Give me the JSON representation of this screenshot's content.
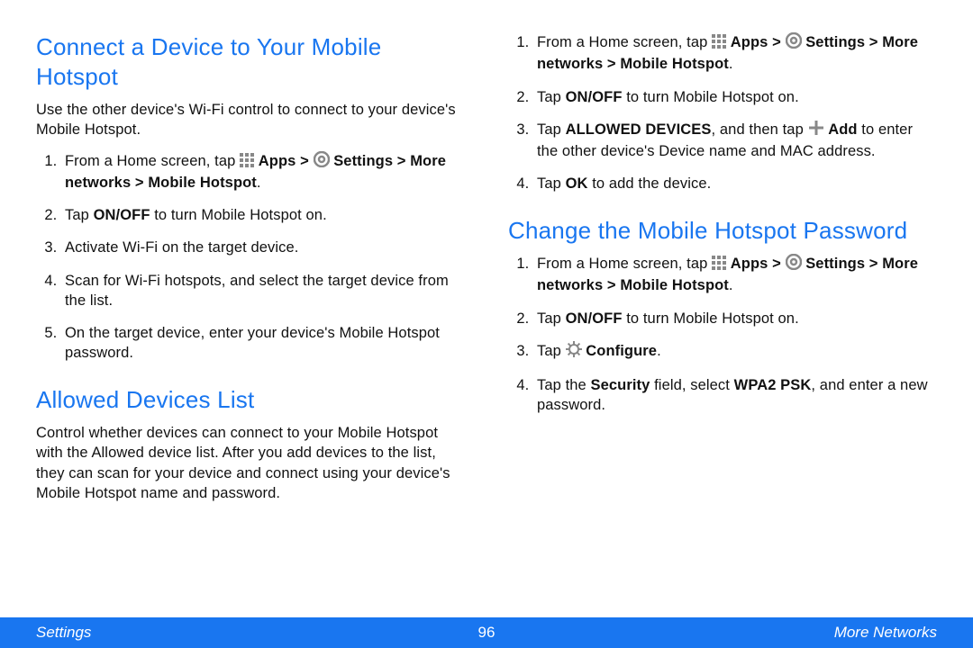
{
  "left": {
    "h1": "Connect a Device to Your Mobile Hotspot",
    "intro1": "Use the other device's Wi-Fi control to connect to your device's Mobile Hotspot.",
    "steps1": {
      "s1_pre": "From a Home screen, tap ",
      "s1_apps": "Apps > ",
      "s1_settings": "Settings > More networks > Mobile Hotspot",
      "s1_post": ".",
      "s2_pre": "Tap ",
      "s2_bold": "ON/OFF",
      "s2_post": " to turn Mobile Hotspot on.",
      "s3": "Activate Wi-Fi on the target device.",
      "s4": "Scan for Wi-Fi hotspots, and select the target device from the list.",
      "s5": "On the target device, enter your device's Mobile Hotspot password."
    },
    "h2": "Allowed Devices List",
    "intro2": "Control whether devices can connect to your Mobile Hotspot with the Allowed device list. After you add devices to the list, they can scan for your device and connect using your device's Mobile Hotspot name and password."
  },
  "right": {
    "stepsA": {
      "s1_pre": "From a Home screen, tap ",
      "s1_apps": "Apps > ",
      "s1_settings": "Settings > More networks > Mobile Hotspot",
      "s1_post": ".",
      "s2_pre": "Tap ",
      "s2_bold": "ON/OFF",
      "s2_post": " to turn Mobile Hotspot on.",
      "s3_pre": "Tap ",
      "s3_bold": "ALLOWED DEVICES",
      "s3_mid": ", and then tap ",
      "s3_add": "Add",
      "s3_post": " to enter the other device's Device name and MAC address.",
      "s4_pre": "Tap ",
      "s4_bold": "OK",
      "s4_post": " to add the device."
    },
    "h1": "Change the Mobile Hotspot Password",
    "stepsB": {
      "s1_pre": "From a Home screen, tap ",
      "s1_apps": "Apps > ",
      "s1_settings": "Settings > More networks > Mobile Hotspot",
      "s1_post": ".",
      "s2_pre": "Tap ",
      "s2_bold": "ON/OFF",
      "s2_post": " to turn Mobile Hotspot on.",
      "s3_pre": "Tap ",
      "s3_bold": "Configure",
      "s3_post": ".",
      "s4_pre": "Tap the ",
      "s4_b1": "Security",
      "s4_mid": " field, select ",
      "s4_b2": "WPA2 PSK",
      "s4_post": ", and enter a new password."
    }
  },
  "footer": {
    "left": "Settings",
    "center": "96",
    "right": "More Networks"
  }
}
